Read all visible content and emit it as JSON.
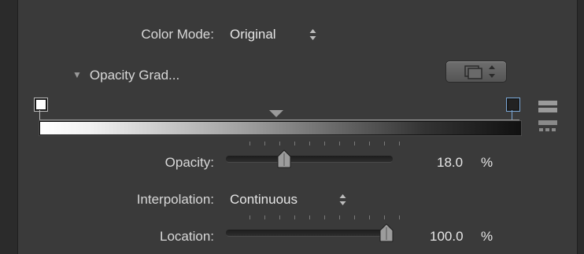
{
  "color_mode": {
    "label": "Color Mode:",
    "value": "Original"
  },
  "opacity_gradient": {
    "title": "Opacity Grad..."
  },
  "opacity": {
    "label": "Opacity:",
    "value": "18.0",
    "unit": "%",
    "fraction": 0.18
  },
  "interpolation": {
    "label": "Interpolation:",
    "value": "Continuous"
  },
  "location": {
    "label": "Location:",
    "value": "100.0",
    "unit": "%",
    "fraction": 1.0
  },
  "icons": {
    "preset": "gradient-preset-icon",
    "stepper": "up-down-stepper-icon",
    "bar_view": "gradient-bar-view-icon",
    "stops_view": "gradient-stops-view-icon"
  },
  "colors": {
    "background": "#3a3a3a",
    "selected_stop_outline": "#7aa7d6"
  }
}
